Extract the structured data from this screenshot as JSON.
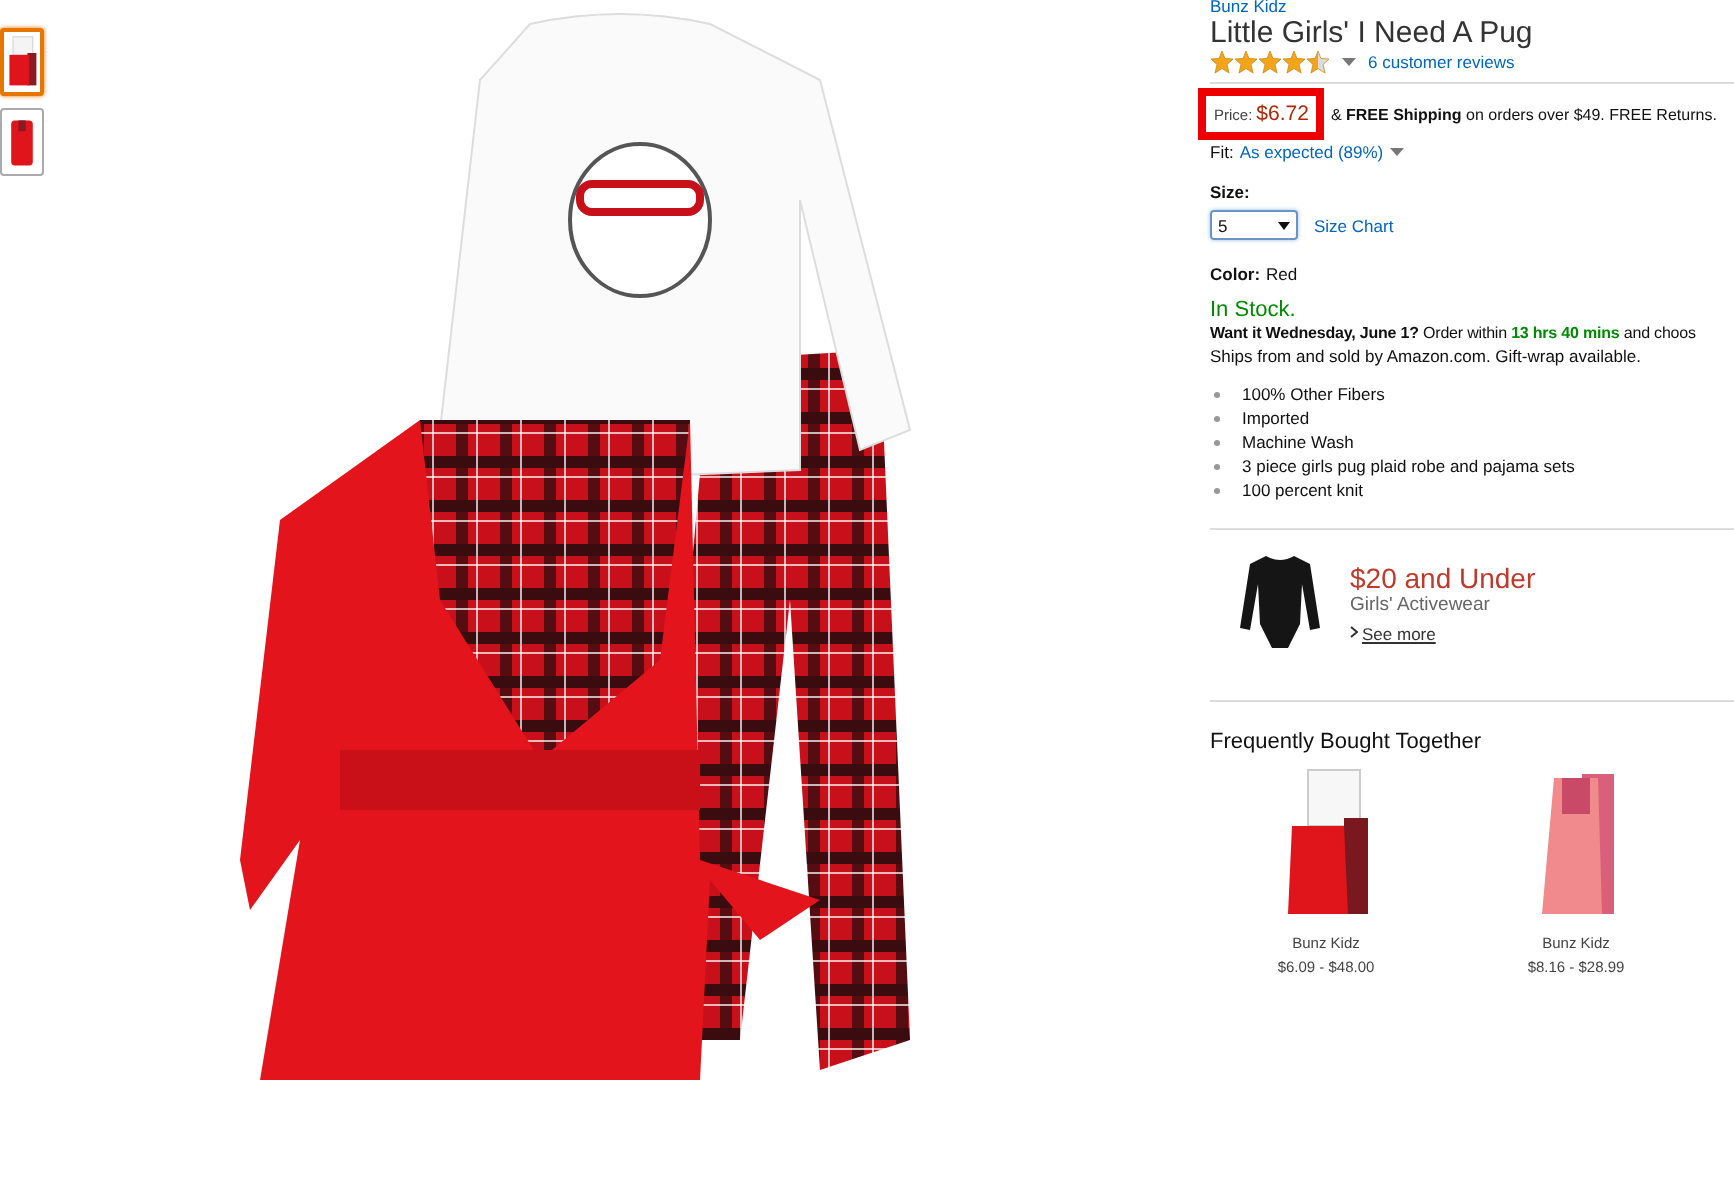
{
  "thumbnails": [
    {
      "selected": true,
      "kind": "set"
    },
    {
      "selected": false,
      "kind": "robe"
    }
  ],
  "product": {
    "brand": "Bunz Kidz",
    "title": "Little Girls' I Need A Pug",
    "stars": 4.5,
    "reviews": "6 customer reviews",
    "price_label": "Price:",
    "price": "$6.72",
    "price_highlighted": true,
    "shipping": "& **FREE Shipping** on orders over $49. FREE Returns.",
    "fit_label": "Fit:",
    "fit_value": "As expected (89%)",
    "size_label": "Size:",
    "size_value": "5",
    "size_chart": "Size Chart",
    "color_label": "Color:",
    "color_value": "Red",
    "stock": "In Stock.",
    "delivery": [
      {
        "kind": "bold",
        "text": "Want it Wednesday, June 1?"
      },
      {
        "kind": "plain",
        "text": " Order within "
      },
      {
        "kind": "green",
        "text": "13 hrs 40 mins"
      },
      {
        "kind": "plain",
        "text": " and choos"
      }
    ],
    "ships": "Ships from and sold by Amazon.com. Gift-wrap available.",
    "bullets": [
      "100% Other Fibers",
      "Imported",
      "Machine Wash",
      "3 piece girls pug plaid robe and pajama sets",
      "100 percent knit"
    ]
  },
  "promo": {
    "title": "$20 and Under",
    "subtitle": "Girls' Activewear",
    "link": "See more"
  },
  "frequently_bought": {
    "heading": "Frequently Bought Together",
    "items": [
      {
        "kind": "red",
        "brand": "Bunz Kidz",
        "price_range": "$6.09 - $48.00"
      },
      {
        "kind": "pink",
        "brand": "Bunz Kidz",
        "price_range": "$8.16 - $28.99"
      }
    ]
  }
}
